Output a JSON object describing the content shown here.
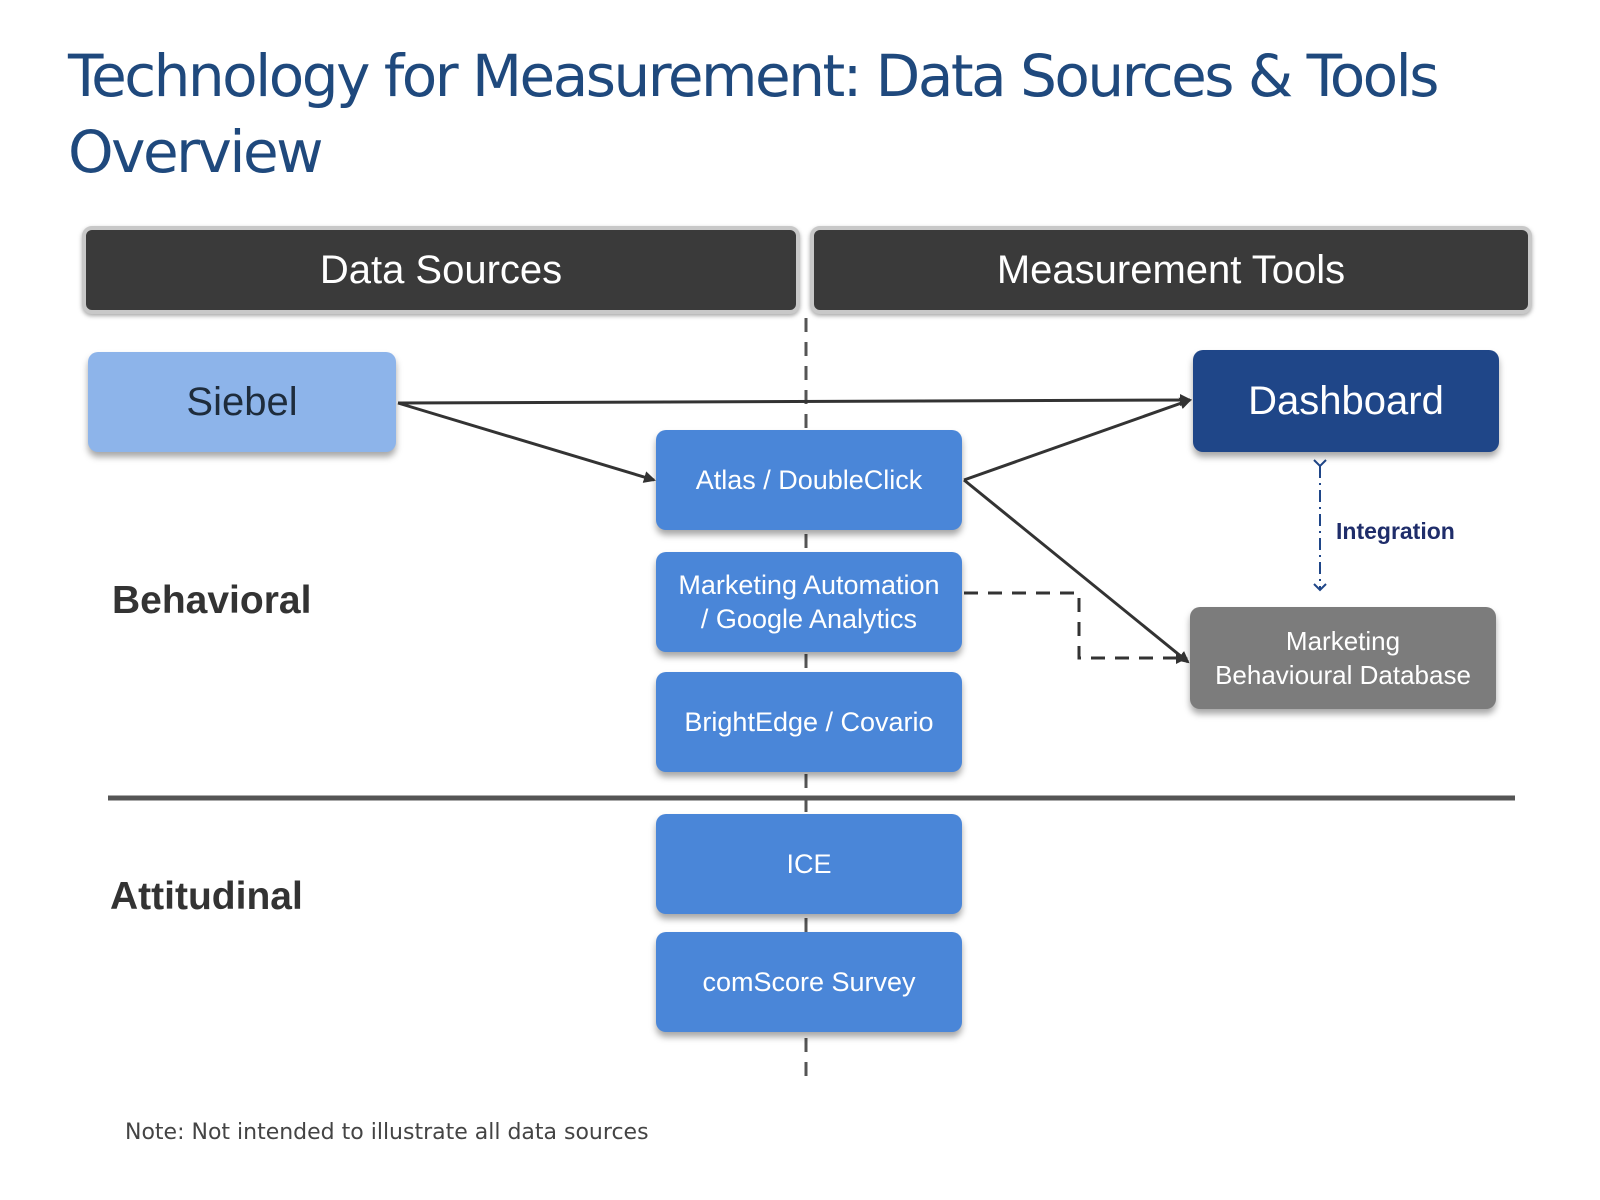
{
  "title": "Technology for Measurement: Data Sources & Tools Overview",
  "headers": {
    "left": "Data Sources",
    "right": "Measurement Tools"
  },
  "rows": {
    "behavioral": "Behavioral",
    "attitudinal": "Attitudinal"
  },
  "nodes": {
    "siebel": "Siebel",
    "atlas": "Atlas / DoubleClick",
    "marketing_automation_line1": "Marketing Automation",
    "marketing_automation_line2": "/ Google Analytics",
    "brightedge": "BrightEdge / Covario",
    "ice": "ICE",
    "comscore": "comScore Survey",
    "dashboard": "Dashboard",
    "mbd_line1": "Marketing",
    "mbd_line2": "Behavioural Database"
  },
  "integration_label": "Integration",
  "note": "Note:  Not intended to illustrate all data sources",
  "colors": {
    "title": "#1f497d",
    "header_bg": "#3a3a3a",
    "siebel": "#8db4ea",
    "source_box": "#4a86d8",
    "dashboard": "#1f4688",
    "database": "#7c7c7c"
  }
}
